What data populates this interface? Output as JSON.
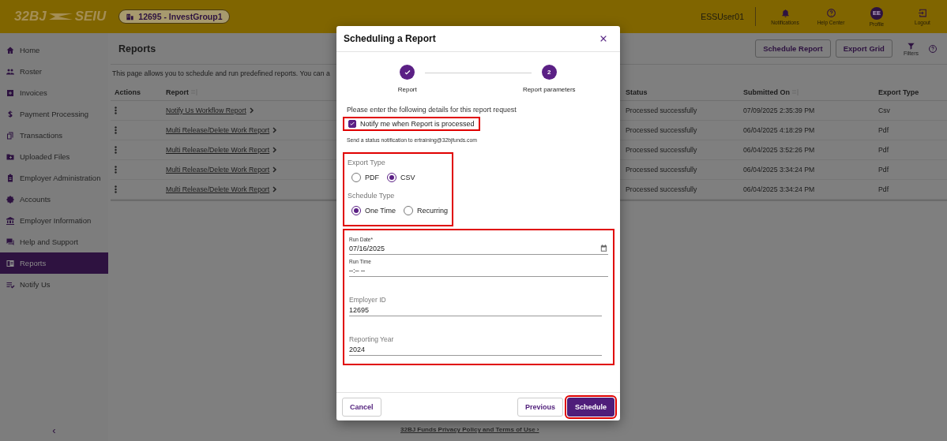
{
  "topbar": {
    "logo_left": "32BJ",
    "logo_right": "SEIU",
    "org_chip": "12695 - InvestGroup1",
    "user": "ESSUser01",
    "actions": [
      {
        "kind": "bell",
        "label": "Notifications"
      },
      {
        "kind": "help",
        "label": "Help Center"
      },
      {
        "kind": "avatar",
        "initials": "EE",
        "label": "Profile"
      },
      {
        "kind": "logout",
        "label": "Logout"
      }
    ]
  },
  "sidebar": {
    "items": [
      {
        "label": "Home",
        "selected": false
      },
      {
        "label": "Roster",
        "selected": false
      },
      {
        "label": "Invoices",
        "selected": false
      },
      {
        "label": "Payment Processing",
        "selected": false
      },
      {
        "label": "Transactions",
        "selected": false
      },
      {
        "label": "Uploaded Files",
        "selected": false
      },
      {
        "label": "Employer Administration",
        "selected": false
      },
      {
        "label": "Accounts",
        "selected": false
      },
      {
        "label": "Employer Information",
        "selected": false
      },
      {
        "label": "Help and Support",
        "selected": false
      },
      {
        "label": "Reports",
        "selected": true
      },
      {
        "label": "Notify Us",
        "selected": false
      }
    ],
    "collapse": "‹"
  },
  "page": {
    "title": "Reports",
    "buttons": [
      "Schedule Report",
      "Export Grid"
    ],
    "filters": "Filters",
    "description": "This page allows you to schedule and run predefined reports. You can a"
  },
  "table": {
    "columns": [
      "Actions",
      "Report",
      "Status",
      "Submitted On",
      "Export Type"
    ],
    "rows": [
      {
        "report": "Notify Us Workflow Report",
        "status": "Processed successfully",
        "submitted": "07/09/2025 2:35:39 PM",
        "export": "Csv"
      },
      {
        "report": "Multi Release/Delete Work Report",
        "status": "Processed successfully",
        "submitted": "06/04/2025 4:18:29 PM",
        "export": "Pdf"
      },
      {
        "report": "Multi Release/Delete Work Report",
        "status": "Processed successfully",
        "submitted": "06/04/2025 3:52:26 PM",
        "export": "Pdf"
      },
      {
        "report": "Multi Release/Delete Work Report",
        "status": "Processed successfully",
        "submitted": "06/04/2025 3:34:24 PM",
        "export": "Pdf"
      },
      {
        "report": "Multi Release/Delete Work Report",
        "status": "Processed successfully",
        "submitted": "06/04/2025 3:34:24 PM",
        "export": "Pdf"
      }
    ]
  },
  "modal": {
    "title": "Scheduling a Report",
    "steps": [
      {
        "label": "Report",
        "done": true
      },
      {
        "label": "Report parameters",
        "number": "2",
        "done": false
      }
    ],
    "intro": "Please enter the following details for this report request",
    "notify": {
      "label": "Notify me when Report is processed",
      "checked": true,
      "highlighted": true
    },
    "notice": "Send a status notification to ertraining@32bjfunds.com",
    "choices": {
      "highlighted": true,
      "groups": [
        {
          "label": "Export Type",
          "options": [
            {
              "label": "PDF",
              "selected": false
            },
            {
              "label": "CSV",
              "selected": true
            }
          ]
        },
        {
          "label": "Schedule Type",
          "options": [
            {
              "label": "One Time",
              "selected": true
            },
            {
              "label": "Recurring",
              "selected": false
            }
          ]
        }
      ]
    },
    "fields": {
      "highlighted": true,
      "items": [
        {
          "kind": "date",
          "label": "Run Date*",
          "value": "07/16/2025"
        },
        {
          "kind": "time",
          "label": "Run Time",
          "value": "–:– –"
        },
        {
          "kind": "text",
          "label": "Employer ID",
          "value": "12695"
        },
        {
          "kind": "text",
          "label": "Reporting Year",
          "value": "2024"
        }
      ]
    },
    "buttons": [
      {
        "kind": "outline",
        "label": "Cancel",
        "highlighted": false
      },
      {
        "kind": "outline",
        "label": "Previous",
        "highlighted": false
      },
      {
        "kind": "primary",
        "label": "Schedule",
        "highlighted": true
      }
    ]
  },
  "footer": {
    "link": "32BJ Funds Privacy Policy and Terms of Use ›"
  }
}
